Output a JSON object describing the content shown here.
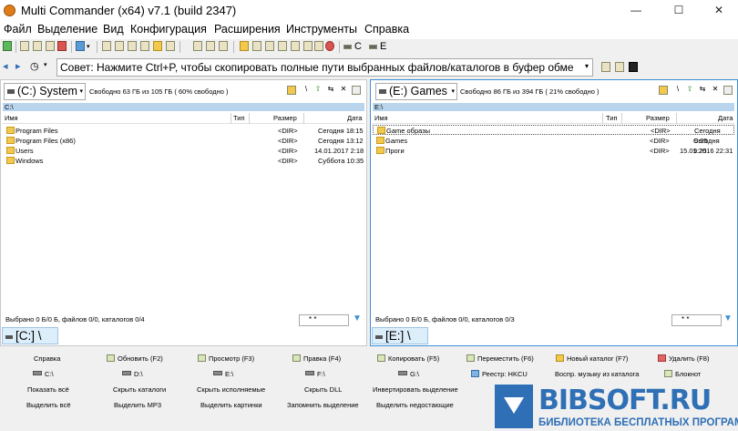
{
  "window": {
    "title": "Multi Commander (x64)  v7.1 (build 2347)",
    "minimize": "—",
    "maximize": "☐",
    "close": "✕"
  },
  "menu": [
    "Файл",
    "Выделение",
    "Вид",
    "Конфигурация",
    "Расширения",
    "Инструменты",
    "Справка"
  ],
  "toolbar": {
    "drive_c": "C",
    "drive_e": "E"
  },
  "tip": {
    "text": "Совет: Нажмите Ctrl+P, чтобы скопировать полные пути выбранных файлов/каталогов в буфер обме",
    "arrow": "▾"
  },
  "left_panel": {
    "drive": "(C:) System",
    "free": "Свободно 63 ГБ из 105 ГБ ( 60% свободно )",
    "path": "C:\\",
    "columns": {
      "name": "Имя",
      "type": "Тип",
      "size": "Размер",
      "date": "Дата"
    },
    "rows": [
      {
        "name": "Program Files",
        "size": "<DIR>",
        "date": "Сегодня 18:15"
      },
      {
        "name": "Program Files (x86)",
        "size": "<DIR>",
        "date": "Сегодня 13:12"
      },
      {
        "name": "Users",
        "size": "<DIR>",
        "date": "14.01.2017 2:18"
      },
      {
        "name": "Windows",
        "size": "<DIR>",
        "date": "Суббота 10:35"
      }
    ],
    "status": "Выбрано 0 Б/0 Б, файлов 0/0, каталогов 0/4",
    "filter": "* *",
    "tab": "[C:] \\"
  },
  "right_panel": {
    "drive": "(E:) Games",
    "free": "Свободно 86 ГБ из 394 ГБ ( 21% свободно )",
    "path": "E:\\",
    "columns": {
      "name": "Имя",
      "type": "Тип",
      "size": "Размер",
      "date": "Дата"
    },
    "rows": [
      {
        "name": "Game образы",
        "size": "<DIR>",
        "date": "Сегодня 9:25"
      },
      {
        "name": "Games",
        "size": "<DIR>",
        "date": "Сегодня 9:25"
      },
      {
        "name": "Проги",
        "size": "<DIR>",
        "date": "15.01.2016 22:31"
      }
    ],
    "status": "Выбрано 0 Б/0 Б, файлов 0/0, каталогов 0/3",
    "filter": "* *",
    "tab": "[E:] \\"
  },
  "buttons": {
    "row1": [
      "Справка",
      "Обновить (F2)",
      "Просмотр (F3)",
      "Правка (F4)",
      "Копировать (F5)",
      "Переместить (F6)",
      "Новый каталог (F7)",
      "Удалить (F8)"
    ],
    "row2": [
      "C:\\",
      "D:\\",
      "E:\\",
      "F:\\",
      "G:\\",
      "Реестр: HKCU",
      "Воспр. музыку из каталога",
      "Блокнот"
    ],
    "row3": [
      "Показать всё",
      "Скрыть каталоги",
      "Скрыть исполняемые",
      "Скрыть DLL",
      "Инвертировать выделение"
    ],
    "row4": [
      "Выделить всё",
      "Выделить MP3",
      "Выделить картинки",
      "Запомнить выделение",
      "Выделить недостающие"
    ]
  },
  "watermark": {
    "name": "BIBSOFT.RU",
    "sub": "БИБЛИОТЕКА БЕСПЛАТНЫХ ПРОГРАММ"
  }
}
